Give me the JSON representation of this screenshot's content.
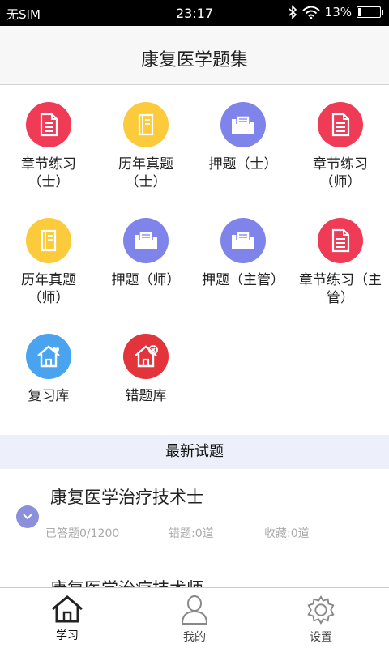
{
  "status_bar": {
    "carrier": "无SIM",
    "time": "23:17",
    "battery": "13%",
    "battery_level": 0.13
  },
  "header": {
    "title": "康复医学题集"
  },
  "grid": [
    {
      "label": "章节练习\n（士）",
      "icon": "document-icon",
      "color": "#ef3b55"
    },
    {
      "label": "历年真题\n（士）",
      "icon": "book-icon",
      "color": "#fbcb3c"
    },
    {
      "label": "押题（士）",
      "icon": "folder-icon",
      "color": "#7e84e9"
    },
    {
      "label": "章节练习\n（师）",
      "icon": "document-icon",
      "color": "#ef3b55"
    },
    {
      "label": "历年真题\n（师）",
      "icon": "book-icon",
      "color": "#fbcb3c"
    },
    {
      "label": "押题（师）",
      "icon": "folder-icon",
      "color": "#7e84e9"
    },
    {
      "label": "押题（主管）",
      "icon": "folder-icon",
      "color": "#7e84e9"
    },
    {
      "label": "章节练习（主\n管）",
      "icon": "document-icon",
      "color": "#ef3b55"
    },
    {
      "label": "复习库",
      "icon": "home-heart-icon",
      "color": "#4aa3ef"
    },
    {
      "label": "错题库",
      "icon": "home-close-icon",
      "color": "#e3333b"
    }
  ],
  "latest": {
    "heading": "最新试题",
    "items": [
      {
        "title": "康复医学治疗技术士",
        "answered": "已答题0/1200",
        "wrong": "错题:0道",
        "favorites": "收藏:0道"
      },
      {
        "title": "康复医学治疗技术师"
      }
    ]
  },
  "tabbar": [
    {
      "label": "学习",
      "icon": "house-icon",
      "active": true
    },
    {
      "label": "我的",
      "icon": "user-icon",
      "active": false
    },
    {
      "label": "设置",
      "icon": "gear-icon",
      "active": false
    }
  ]
}
